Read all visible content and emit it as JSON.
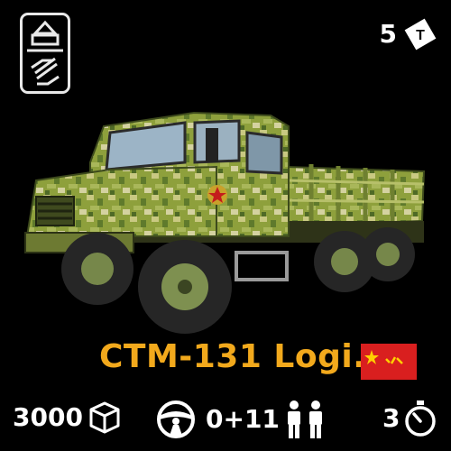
{
  "vehicle": {
    "name": "CTM-131 Logi.",
    "tier": "5",
    "class_icon": "logistics-truck-icon",
    "tier_icon": "tier-badge-icon",
    "art_icon": "military-truck-illustration",
    "faction_flag": "china-ba-yi-flag"
  },
  "stats": {
    "cargo": "3000",
    "cargo_icon": "cargo-box-icon",
    "driver_icon": "steering-wheel-icon",
    "crew": "0+11",
    "crew_icon": "passengers-icon",
    "respawn": "3",
    "respawn_icon": "stopwatch-icon"
  },
  "colors": {
    "name_color": "#f2a91c",
    "flag_red": "#d91f1f",
    "flag_gold": "#ffd000",
    "text": "#ffffff",
    "background": "#000000"
  }
}
